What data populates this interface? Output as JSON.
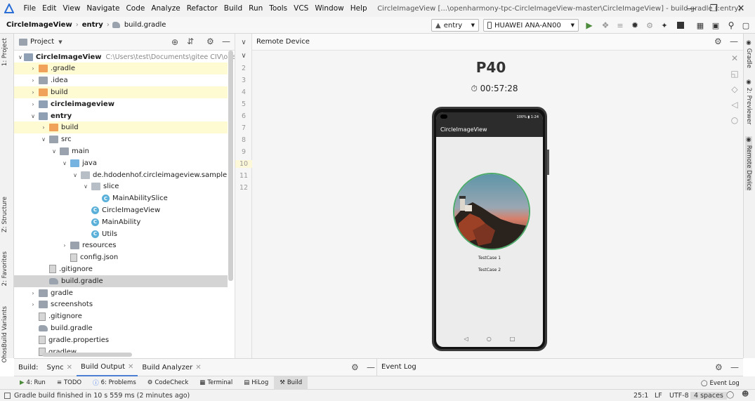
{
  "menubar": {
    "items": [
      "File",
      "Edit",
      "View",
      "Navigate",
      "Code",
      "Analyze",
      "Refactor",
      "Build",
      "Run",
      "Tools",
      "VCS",
      "Window",
      "Help"
    ],
    "window_title": "CircleImageView [...\\openharmony-tpc-CircleImageView-master\\CircleImageView] - build.gradle (:entry)"
  },
  "navbar": {
    "crumbs": [
      "CircleImageView",
      "entry",
      "build.gradle"
    ],
    "run_config": "entry",
    "device": "HUAWEI ANA-AN00"
  },
  "left_strip": {
    "tabs": [
      "1: Project",
      "Z: Structure",
      "2: Favorites",
      "OhosBuild Variants"
    ]
  },
  "right_strip": {
    "tabs": [
      "Gradle",
      "2: Previewer",
      "Remote Device"
    ]
  },
  "project": {
    "header": "Project",
    "tree": [
      {
        "label": "CircleImageView",
        "hint": "C:\\Users\\test\\Documents\\gitee CIV\\openha",
        "icon": "module",
        "bold": true,
        "depth": 0,
        "arrow": "v",
        "hl": false,
        "sel": false
      },
      {
        "label": ".gradle",
        "icon": "folder-orange",
        "depth": 1,
        "arrow": ">",
        "hl": true
      },
      {
        "label": ".idea",
        "icon": "folder",
        "depth": 1,
        "arrow": ">"
      },
      {
        "label": "build",
        "icon": "folder-orange",
        "depth": 1,
        "arrow": ">",
        "hl": true
      },
      {
        "label": "circleimageview",
        "icon": "module",
        "bold": true,
        "depth": 1,
        "arrow": ">"
      },
      {
        "label": "entry",
        "icon": "module",
        "bold": true,
        "depth": 1,
        "arrow": "v"
      },
      {
        "label": "build",
        "icon": "folder-orange",
        "depth": 2,
        "arrow": ">",
        "hl": true
      },
      {
        "label": "src",
        "icon": "folder",
        "depth": 2,
        "arrow": "v"
      },
      {
        "label": "main",
        "icon": "folder",
        "depth": 3,
        "arrow": "v"
      },
      {
        "label": "java",
        "icon": "folder-blue",
        "depth": 4,
        "arrow": "v"
      },
      {
        "label": "de.hdodenhof.circleimageview.sample",
        "icon": "package",
        "depth": 5,
        "arrow": "v"
      },
      {
        "label": "slice",
        "icon": "package",
        "depth": 6,
        "arrow": "v"
      },
      {
        "label": "MainAbilitySlice",
        "icon": "class",
        "depth": 7,
        "arrow": ""
      },
      {
        "label": "CircleImageView",
        "icon": "class",
        "depth": 6,
        "arrow": ""
      },
      {
        "label": "MainAbility",
        "icon": "class",
        "depth": 6,
        "arrow": ""
      },
      {
        "label": "Utils",
        "icon": "class",
        "depth": 6,
        "arrow": ""
      },
      {
        "label": "resources",
        "icon": "folder",
        "depth": 4,
        "arrow": ">"
      },
      {
        "label": "config.json",
        "icon": "file",
        "depth": 4,
        "arrow": ""
      },
      {
        "label": ".gitignore",
        "icon": "file",
        "depth": 2,
        "arrow": ""
      },
      {
        "label": "build.gradle",
        "icon": "gradle",
        "depth": 2,
        "arrow": "",
        "sel": true
      },
      {
        "label": "gradle",
        "icon": "folder",
        "depth": 1,
        "arrow": ">"
      },
      {
        "label": "screenshots",
        "icon": "folder",
        "depth": 1,
        "arrow": ">"
      },
      {
        "label": ".gitignore",
        "icon": "file",
        "depth": 1,
        "arrow": ""
      },
      {
        "label": "build.gradle",
        "icon": "gradle",
        "depth": 1,
        "arrow": ""
      },
      {
        "label": "gradle.properties",
        "icon": "file",
        "depth": 1,
        "arrow": ""
      },
      {
        "label": "gradlew",
        "icon": "file",
        "depth": 1,
        "arrow": ""
      }
    ]
  },
  "editor": {
    "line_numbers": [
      "2",
      "3",
      "4",
      "5",
      "6",
      "7",
      "8",
      "9",
      "10",
      "11",
      "12"
    ],
    "current_line": "10"
  },
  "preview": {
    "header": "Remote Device",
    "device_name": "P40",
    "timer": "00:57:28",
    "status_right": "100% ▮ 1:24",
    "app_title": "CircleImageView",
    "testcase1": "TestCase 1",
    "testcase2": "TestCase 2"
  },
  "build_panel": {
    "label": "Build:",
    "tabs": [
      "Sync",
      "Build Output",
      "Build Analyzer"
    ],
    "active_tab": "Build Output",
    "event_log": "Event Log"
  },
  "toolwindows": {
    "items": [
      "4: Run",
      "TODO",
      "6: Problems",
      "CodeCheck",
      "Terminal",
      "HiLog",
      "Build"
    ],
    "active": "Build",
    "event_log": "Event Log"
  },
  "statusline": {
    "message": "Gradle build finished in 10 s 559 ms (2 minutes ago)",
    "position": "25:1",
    "line_sep": "LF",
    "encoding": "UTF-8",
    "indent": "4 spaces"
  },
  "colors": {
    "accent": "#4a7fd4",
    "highlight_row": "#fefad2",
    "selected_row": "#d4d4d4",
    "class_icon": "#5ab0d8"
  }
}
